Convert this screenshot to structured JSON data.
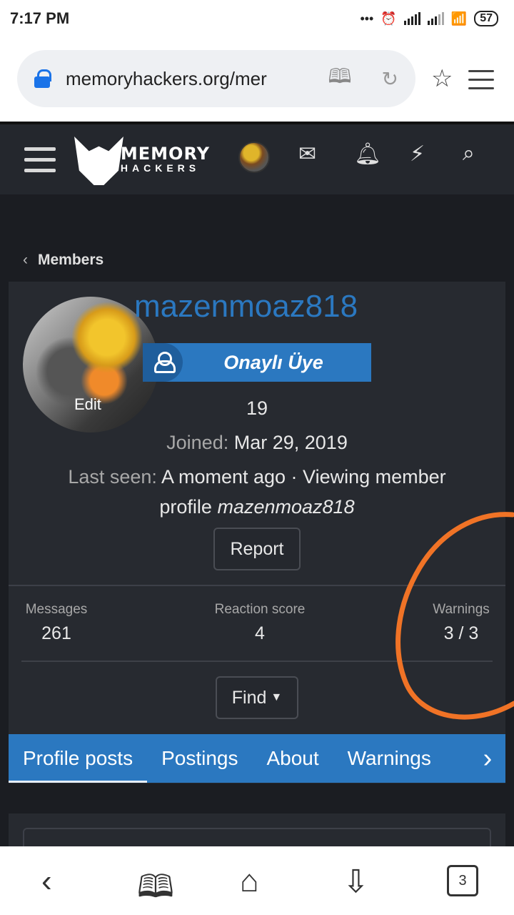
{
  "status_bar": {
    "time": "7:17 PM",
    "battery": "57"
  },
  "browser": {
    "url": "memoryhackers.org/mer",
    "open_tabs": "3"
  },
  "site": {
    "logo_top": "MEMORY",
    "logo_bottom": "HACKERS"
  },
  "breadcrumb": {
    "label": "Members"
  },
  "profile": {
    "username": "mazenmoaz818",
    "avatar_edit": "Edit",
    "badge": "Onaylı Üye",
    "number": "19",
    "joined_label": "Joined:",
    "joined_value": "Mar 29, 2019",
    "last_seen_label": "Last seen:",
    "last_seen_value": "A moment ago · Viewing member",
    "last_seen_cont": "profile",
    "last_seen_user": "mazenmoaz818",
    "report_label": "Report"
  },
  "stats": [
    {
      "label": "Messages",
      "value": "261"
    },
    {
      "label": "Reaction score",
      "value": "4"
    },
    {
      "label": "Warnings",
      "value": "3 / 3"
    }
  ],
  "find_label": "Find",
  "tabs": [
    "Profile posts",
    "Postings",
    "About",
    "Warnings"
  ],
  "annotation_color": "#f07326",
  "accent_color": "#2b78c0"
}
